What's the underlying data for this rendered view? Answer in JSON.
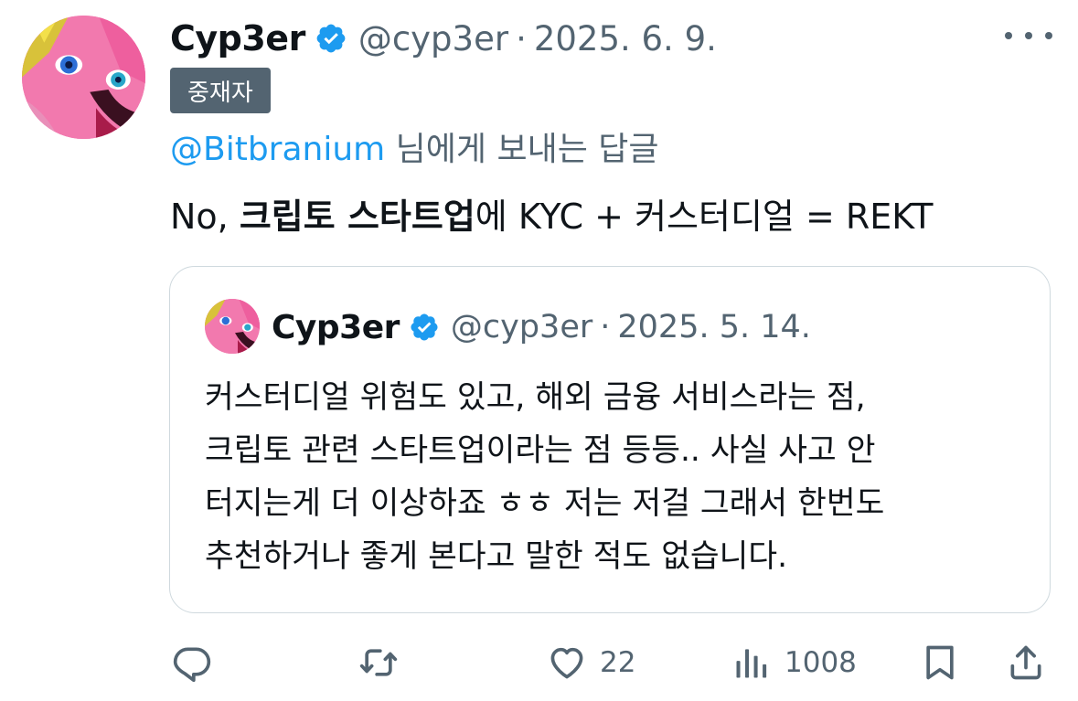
{
  "tweet": {
    "author_name": "Cyp3er",
    "handle": "@cyp3er",
    "separator": "·",
    "date": "2025. 6. 9.",
    "badge": "중재자",
    "reply_to_mention": "@Bitbranium",
    "reply_to_suffix": " 님에게 보내는 답글",
    "text_prefix": "No, ",
    "text_bold": "크립토 스타트업",
    "text_suffix": "에 KYC + 커스터디얼 = REKT"
  },
  "quote": {
    "author_name": "Cyp3er",
    "handle": "@cyp3er",
    "separator": "·",
    "date": "2025. 5. 14.",
    "lines": [
      "커스터디얼 위험도 있고, 해외 금융 서비스라는 점,",
      "크립토 관련 스타트업이라는 점 등등.. 사실 사고 안",
      "터지는게 더 이상하죠 ㅎㅎ 저는 저걸 그래서 한번도",
      "추천하거나 좋게 본다고 말한 적도 없습니다."
    ]
  },
  "actions": {
    "reply_icon": "reply-icon",
    "retweet_icon": "retweet-icon",
    "like_icon": "heart-icon",
    "like_count": "22",
    "views_icon": "views-icon",
    "views_count": "1008",
    "bookmark_icon": "bookmark-icon",
    "share_icon": "share-icon"
  },
  "colors": {
    "text": "#0f1419",
    "secondary": "#536471",
    "link": "#1d9bf0",
    "border": "#cfd9de",
    "verified": "#1d9bf0"
  }
}
